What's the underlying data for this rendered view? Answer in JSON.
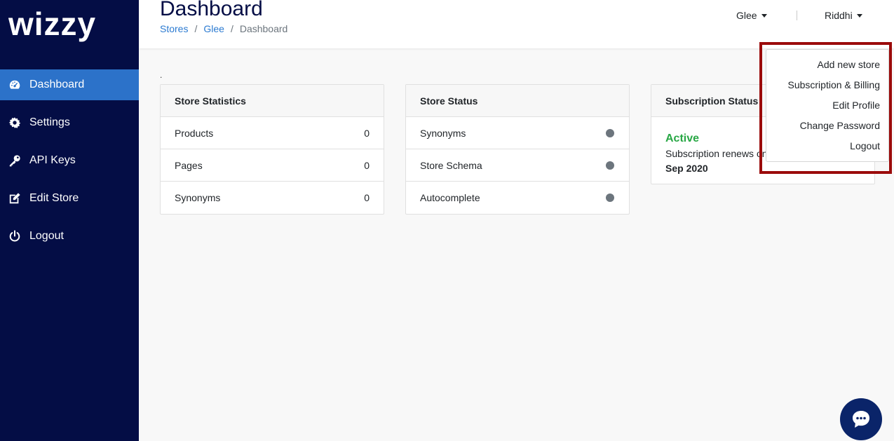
{
  "brand": {
    "logo_text": "wizzy"
  },
  "sidebar": {
    "items": [
      {
        "label": "Dashboard",
        "icon": "dashboard-icon",
        "active": true
      },
      {
        "label": "Settings",
        "icon": "gear-icon",
        "active": false
      },
      {
        "label": "API Keys",
        "icon": "key-icon",
        "active": false
      },
      {
        "label": "Edit Store",
        "icon": "edit-icon",
        "active": false
      },
      {
        "label": "Logout",
        "icon": "power-icon",
        "active": false
      }
    ]
  },
  "header": {
    "title": "Dashboard",
    "breadcrumb": {
      "item1": "Stores",
      "item2": "Glee",
      "current": "Dashboard",
      "separator": "/"
    },
    "store_selector": "Glee",
    "user_menu": "Riddhi"
  },
  "content": {
    "marker": ".",
    "store_statistics": {
      "title": "Store Statistics",
      "rows": [
        {
          "label": "Products",
          "value": "0"
        },
        {
          "label": "Pages",
          "value": "0"
        },
        {
          "label": "Synonyms",
          "value": "0"
        }
      ]
    },
    "store_status": {
      "title": "Store Status",
      "rows": [
        {
          "label": "Synonyms"
        },
        {
          "label": "Store Schema"
        },
        {
          "label": "Autocomplete"
        }
      ]
    },
    "subscription_status": {
      "title": "Subscription Status",
      "status": "Active",
      "renews_text": "Subscription renews on",
      "date": "Sep 2020"
    }
  },
  "user_dropdown": {
    "items": [
      "Add new store",
      "Subscription & Billing",
      "Edit Profile",
      "Change Password",
      "Logout"
    ]
  },
  "colors": {
    "sidebar_bg": "#040d45",
    "active_nav": "#2c72c9",
    "link": "#2c7bd1",
    "active_status": "#28a745",
    "highlight": "#9b0b0b",
    "chat_button": "#0a2469"
  },
  "chat": {
    "icon": "chat-bubble-icon"
  }
}
